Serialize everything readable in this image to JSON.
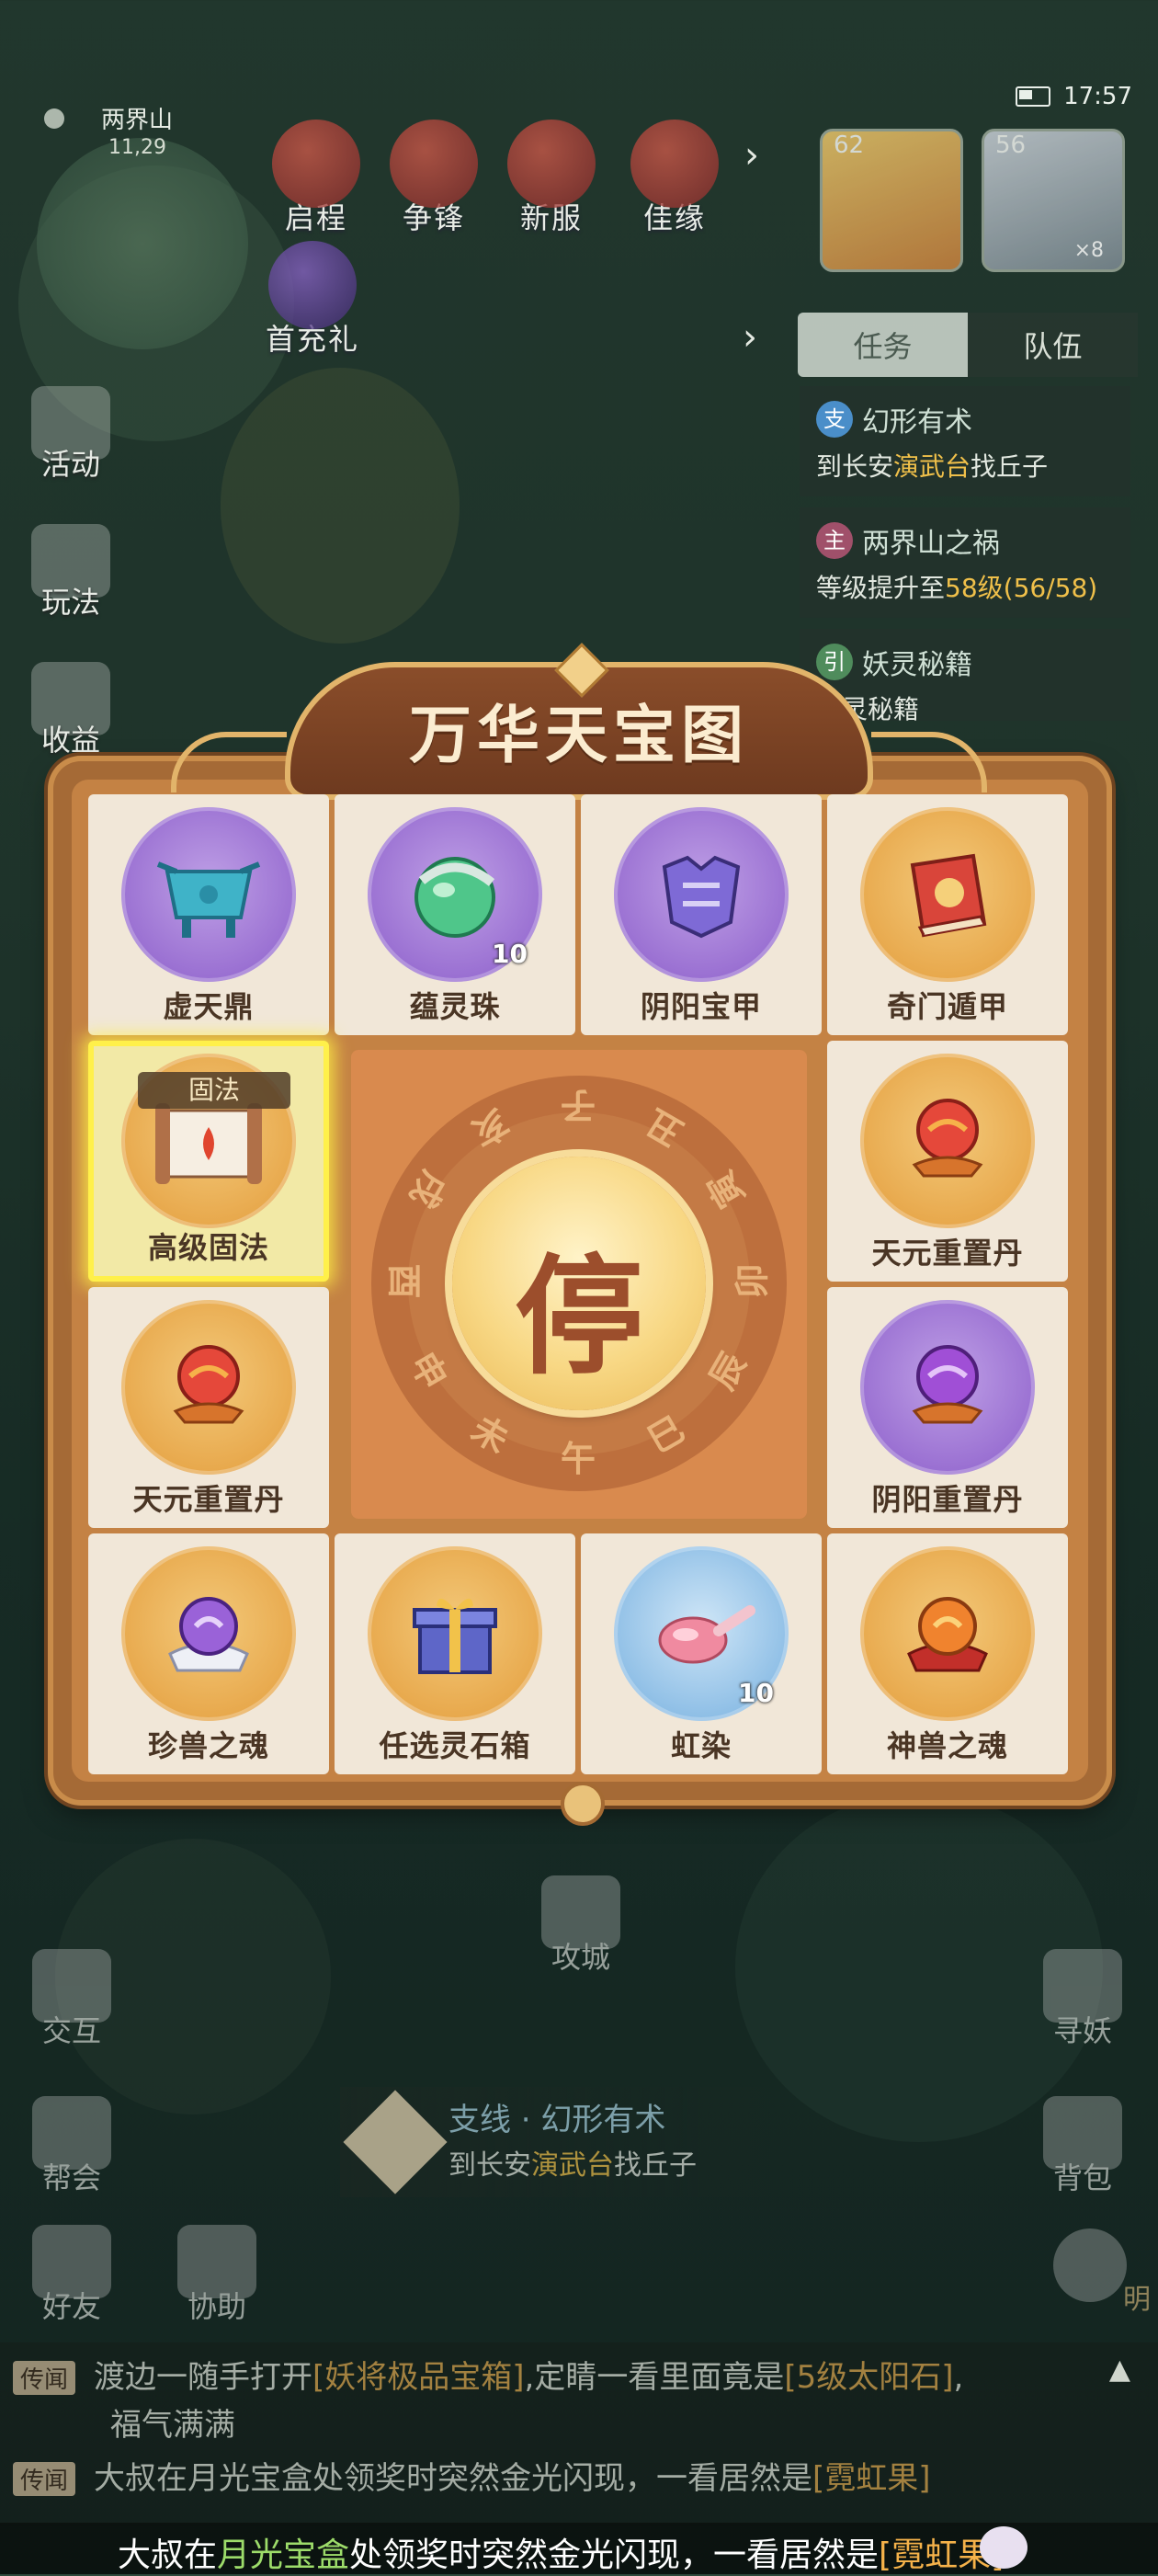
{
  "status": {
    "time": "17:57"
  },
  "location": {
    "name": "两界山",
    "coords": "11,29"
  },
  "top_icons": [
    "启程",
    "争锋",
    "新服",
    "佳缘"
  ],
  "first_charge": "首充礼",
  "portraits": [
    {
      "level": "62"
    },
    {
      "level": "56",
      "badge": "×8"
    }
  ],
  "task_tabs": [
    "任务",
    "队伍"
  ],
  "tasks": [
    {
      "tag": "支",
      "title": "幻形有术",
      "desc_prefix": "到长安",
      "desc_highlight": "演武台",
      "desc_suffix": "找丘子",
      "tag_color": "#4a8ec9"
    },
    {
      "tag": "主",
      "title": "两界山之祸",
      "desc_prefix": "等级提升至",
      "desc_highlight": "58级(56/58)",
      "desc_suffix": "",
      "tag_color": "#a0506a"
    },
    {
      "tag": "引",
      "title": "妖灵秘籍",
      "desc_prefix": "妖灵秘籍",
      "desc_highlight": "",
      "desc_suffix": "",
      "tag_color": "#4f8c5c"
    }
  ],
  "left_icons": [
    "活动",
    "玩法",
    "收益"
  ],
  "popup": {
    "title": "万华天宝图",
    "stop_label": "停",
    "zodiac": [
      "子",
      "丑",
      "寅",
      "卯",
      "辰",
      "巳",
      "午",
      "未",
      "申",
      "酉",
      "戌",
      "亥"
    ],
    "items": [
      {
        "name": "虚天鼎",
        "orb": "purple",
        "count": ""
      },
      {
        "name": "蕴灵珠",
        "orb": "purple",
        "count": "10"
      },
      {
        "name": "阴阳宝甲",
        "orb": "purple",
        "count": ""
      },
      {
        "name": "奇门遁甲",
        "orb": "gold",
        "count": ""
      },
      {
        "name": "高级固法",
        "orb": "gold",
        "count": "",
        "tag": "固法",
        "selected": true
      },
      {
        "name": "天元重置丹",
        "orb": "gold",
        "count": ""
      },
      {
        "name": "天元重置丹",
        "orb": "gold",
        "count": ""
      },
      {
        "name": "阴阳重置丹",
        "orb": "purple",
        "count": ""
      },
      {
        "name": "珍兽之魂",
        "orb": "gold",
        "count": ""
      },
      {
        "name": "任选灵石箱",
        "orb": "gold",
        "count": ""
      },
      {
        "name": "虹染",
        "orb": "blue",
        "count": "10"
      },
      {
        "name": "神兽之魂",
        "orb": "gold",
        "count": ""
      }
    ]
  },
  "hud": {
    "siege": "攻城",
    "trade": "交互",
    "guild": "帮会",
    "friends": "好友",
    "assist": "协助",
    "seek": "寻妖",
    "bag": "背包",
    "side_hint": "明"
  },
  "quest_bar": {
    "title": "支线 · 幻形有术",
    "desc_prefix": "到长安",
    "desc_highlight": "演武台",
    "desc_suffix": "找丘子"
  },
  "chat": [
    {
      "channel": "传闻",
      "text_a": "渡边一随手打开",
      "gold_a": "[妖将极品宝箱]",
      "text_b": ",定睛一看里面竟是",
      "gold_b": "[5级太阳石]",
      "text_c": ",",
      "line2": "福气满满"
    },
    {
      "channel": "传闻",
      "text_a": "大叔在月光宝盒处领奖时突然金光闪现，一看居然是",
      "gold_a": "[霓虹果]"
    }
  ],
  "ticker": {
    "a": "大叔在",
    "g": "月光宝盒",
    "b": "处领奖时突然金光闪现，一看居然是",
    "o": "[霓虹果]"
  }
}
